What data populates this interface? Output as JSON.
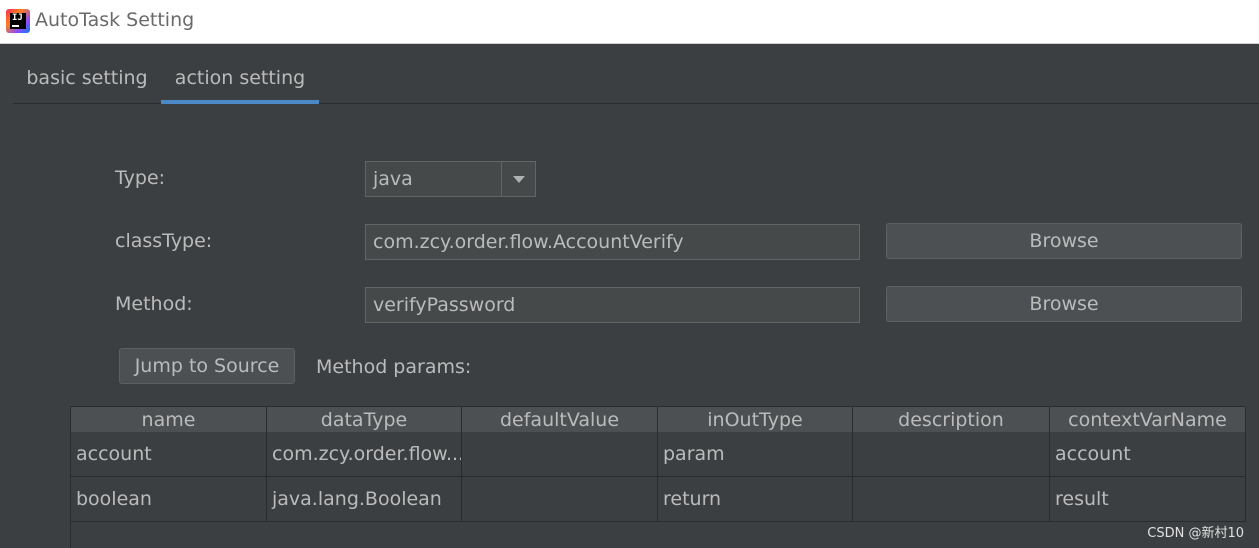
{
  "window": {
    "title": "AutoTask Setting",
    "icon": "intellij-idea-icon"
  },
  "tabs": [
    {
      "label": "basic setting",
      "active": false
    },
    {
      "label": "action setting",
      "active": true
    }
  ],
  "form": {
    "type_label": "Type:",
    "type_value": "java",
    "class_label": "classType:",
    "class_value": "com.zcy.order.flow.AccountVerify",
    "class_browse": "Browse",
    "method_label": "Method:",
    "method_value": "verifyPassword",
    "method_browse": "Browse",
    "jump_button": "Jump to Source",
    "params_label": "Method params:"
  },
  "table": {
    "columns": [
      "name",
      "dataType",
      "defaultValue",
      "inOutType",
      "description",
      "contextVarName"
    ],
    "rows": [
      [
        "account",
        "com.zcy.order.flow....",
        "",
        "param",
        "",
        "account"
      ],
      [
        "boolean",
        "java.lang.Boolean",
        "",
        "return",
        "",
        "result"
      ]
    ]
  },
  "watermark": "CSDN @新村10",
  "colors": {
    "background": "#3c3f41",
    "accent": "#4a88c7",
    "field": "#45494a"
  }
}
